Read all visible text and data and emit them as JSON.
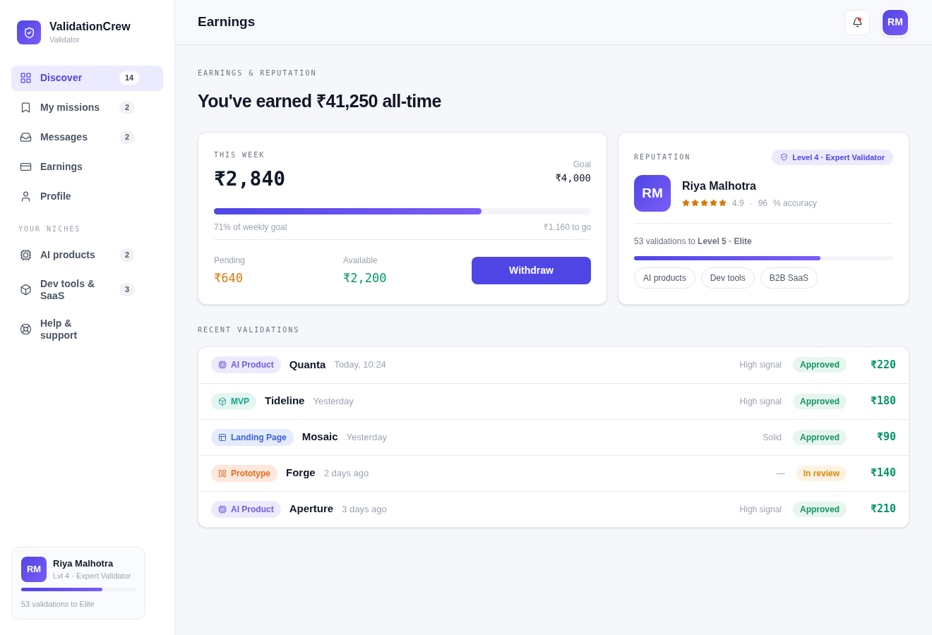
{
  "brand": {
    "name": "ValidationCrew",
    "role": "Validator"
  },
  "nav": [
    {
      "label": "Discover",
      "badge": "14",
      "selected": true
    },
    {
      "label": "My missions",
      "badge": "2",
      "selected": false
    },
    {
      "label": "Messages",
      "badge": "2",
      "selected": false
    },
    {
      "label": "Earnings",
      "selected": false
    },
    {
      "label": "Profile",
      "selected": false
    }
  ],
  "niches_heading": "YOUR NICHES",
  "niches": [
    {
      "label": "AI products",
      "badge": "2",
      "selected": false
    },
    {
      "label": "Dev tools & SaaS",
      "badge": "3",
      "selected": false
    }
  ],
  "help": {
    "label": "Help & support",
    "selected": false
  },
  "user_card": {
    "initials": "RM",
    "name": "Riya Malhotra",
    "level_text": "Lvl 4 · Expert Validator",
    "level": 0.71,
    "caption": "53 validations to Elite"
  },
  "header": {
    "title": "Earnings",
    "avatar": "RM",
    "notification": true
  },
  "eyebrow": "EARNINGS & REPUTATION",
  "headline": "You've earned ₹41,250 all-time",
  "week": {
    "label": "THIS WEEK",
    "amount": "₹2,840",
    "goal_label": "Goal",
    "goal": "₹4,000",
    "level": 0.71,
    "progress_text": "71% of weekly goal",
    "remaining": "₹1,160 to go",
    "pending_label": "Pending",
    "pending": "₹640",
    "available_label": "Available",
    "available": "₹2,200",
    "button": "Withdraw"
  },
  "reputation": {
    "label": "REPUTATION",
    "badge_text": "Level 4 · Expert Validator",
    "initials": "RM",
    "name": "Riya Malhotra",
    "stars": 5,
    "rating": "4.9",
    "separator": "·",
    "accuracy": "96",
    "accuracy_label": "% accuracy",
    "progress_text": "53 validations to **Level 5 · Elite**",
    "level": 0.72,
    "tags": [
      "AI products",
      "Dev tools",
      "B2B SaaS"
    ]
  },
  "recent_heading": "RECENT VALIDATIONS",
  "validations": [
    {
      "tag": "AI Product",
      "kind": "ai",
      "name": "Quanta",
      "time": "Today, 10:24",
      "signal": "High signal",
      "status": {
        "text": "Approved",
        "kind": "approved"
      },
      "amount": "₹220"
    },
    {
      "tag": "MVP",
      "kind": "mvp",
      "name": "Tideline",
      "time": "Yesterday",
      "signal": "High signal",
      "status": {
        "text": "Approved",
        "kind": "approved"
      },
      "amount": "₹180"
    },
    {
      "tag": "Landing Page",
      "kind": "landing",
      "name": "Mosaic",
      "time": "Yesterday",
      "signal": "Solid",
      "status": {
        "text": "Approved",
        "kind": "approved"
      },
      "amount": "₹90"
    },
    {
      "tag": "Prototype",
      "kind": "prototype",
      "name": "Forge",
      "time": "2 days ago",
      "signal": "—",
      "status": {
        "text": "In review",
        "kind": "review"
      },
      "amount": "₹140"
    },
    {
      "tag": "AI Product",
      "kind": "ai",
      "name": "Aperture",
      "time": "3 days ago",
      "signal": "High signal",
      "status": {
        "text": "Approved",
        "kind": "approved"
      },
      "amount": "₹210"
    }
  ]
}
